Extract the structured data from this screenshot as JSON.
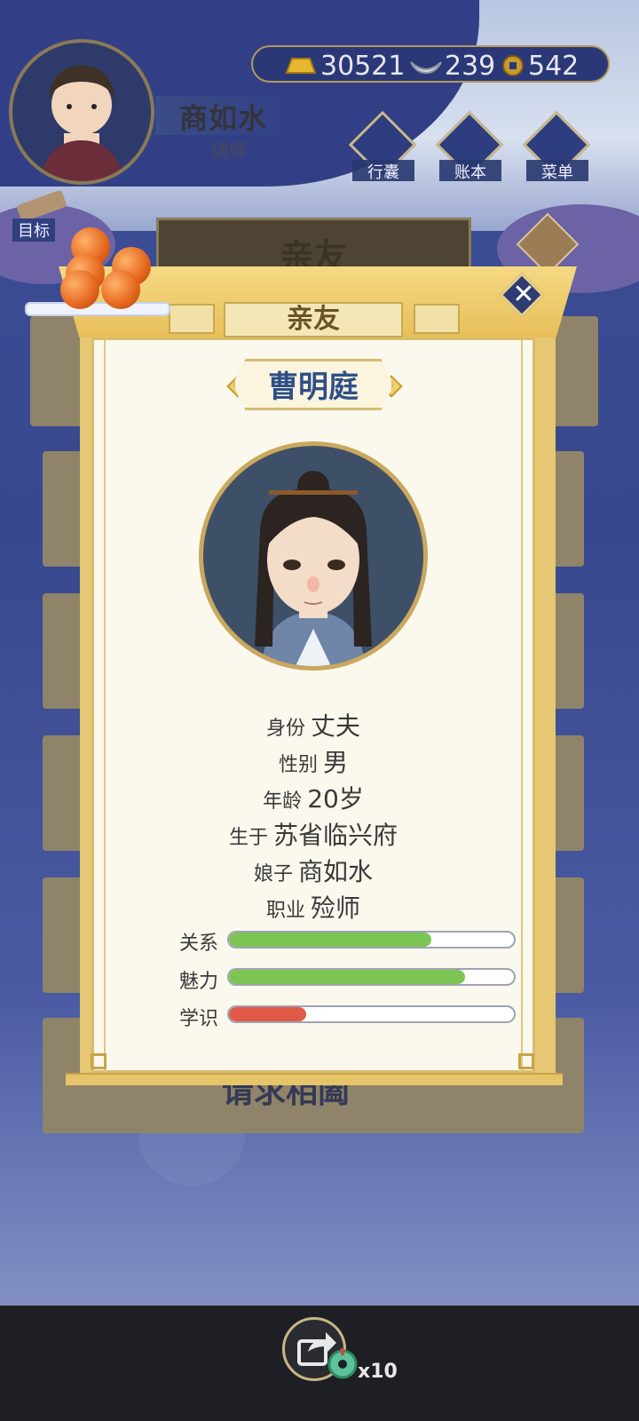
{
  "player": {
    "name": "商如水",
    "title": "绣师",
    "target_label": "目标"
  },
  "currency": {
    "gold": "30521",
    "silver": "239",
    "coins": "542"
  },
  "top_menu": [
    {
      "label": "行囊",
      "icon": "bag-icon"
    },
    {
      "label": "账本",
      "icon": "ledger-icon"
    },
    {
      "label": "菜单",
      "icon": "menu-dots-icon"
    }
  ],
  "background_page": {
    "title": "亲友",
    "bottom_text": "请求相阖"
  },
  "modal": {
    "title": "亲友",
    "character_name": "曹明庭",
    "info": [
      {
        "key": "身份",
        "value": "丈夫"
      },
      {
        "key": "性别",
        "value": "男"
      },
      {
        "key": "年龄",
        "value": "20岁"
      },
      {
        "key": "生于",
        "value": "苏省临兴府"
      },
      {
        "key": "娘子",
        "value": "商如水"
      },
      {
        "key": "职业",
        "value": "殓师"
      }
    ],
    "stats": [
      {
        "label": "关系",
        "fraction": 0.71,
        "color": "#7cc552"
      },
      {
        "label": "魅力",
        "fraction": 0.83,
        "color": "#7cc552"
      },
      {
        "label": "学识",
        "fraction": 0.27,
        "color": "#e05a47"
      }
    ]
  },
  "bottom_bar": {
    "share_icon": "share-arrow-icon",
    "reward_count": "x10"
  }
}
